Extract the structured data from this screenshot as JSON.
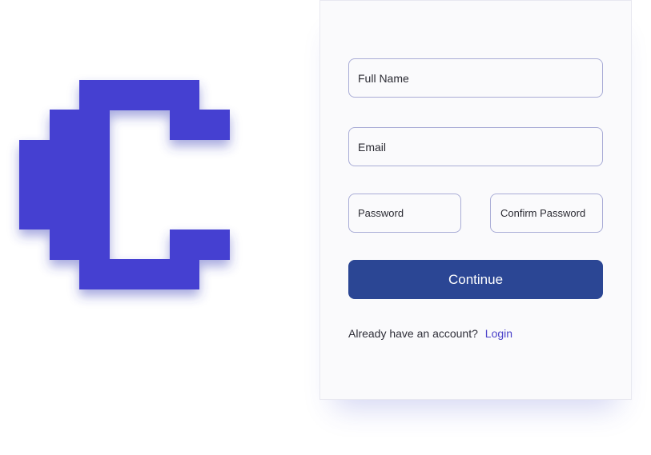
{
  "brand": {
    "logo_icon": "pixel-letter-c-logo",
    "logo_color": "#4541d1"
  },
  "form": {
    "full_name_placeholder": "Full Name",
    "email_placeholder": "Email",
    "password_placeholder": "Password",
    "confirm_password_placeholder": "Confirm Password",
    "continue_label": "Continue",
    "continue_color": "#2b4694",
    "account_prompt": "Already have an account?",
    "login_label": "Login",
    "link_color": "#4a41c9"
  }
}
